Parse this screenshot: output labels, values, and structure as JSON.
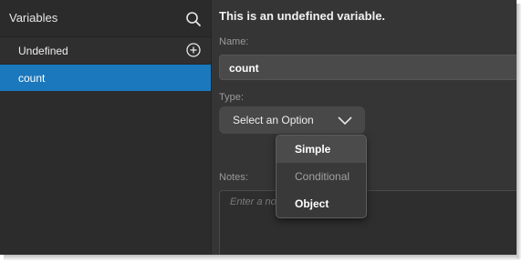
{
  "sidebar": {
    "title": "Variables",
    "items": [
      {
        "label": "Undefined"
      },
      {
        "label": "count"
      }
    ]
  },
  "main": {
    "heading": "This is an undefined variable.",
    "name_label": "Name:",
    "name_value": "count",
    "type_label": "Type:",
    "type_select": "Select an Option",
    "type_options": [
      {
        "label": "Simple",
        "state": "hover"
      },
      {
        "label": "Conditional",
        "state": "disabled"
      },
      {
        "label": "Object",
        "state": "normal"
      }
    ],
    "notes_label": "Notes:",
    "notes_placeholder": "Enter a no"
  },
  "colors": {
    "accent": "#1b78bd",
    "background": "#353535",
    "sidebar": "#2c2c2c"
  },
  "icons": {
    "search": "search-icon",
    "add": "add-circle-icon",
    "chevron": "chevron-down-icon"
  }
}
